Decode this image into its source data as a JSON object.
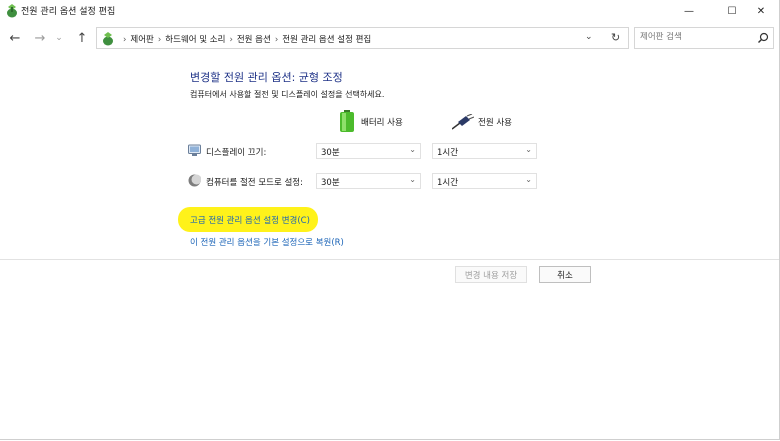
{
  "window": {
    "title": "전원 관리 옵션 설정 편집"
  },
  "titlebar": {
    "minimize": "—",
    "maximize": "☐",
    "close": "✕"
  },
  "nav": {
    "breadcrumbs": [
      "제어판",
      "하드웨어 및 소리",
      "전원 옵션",
      "전원 관리 옵션 설정 편집"
    ],
    "separator": "›",
    "search_placeholder": "제어판 검색"
  },
  "main": {
    "heading": "변경할 전원 관리 옵션: 균형 조정",
    "description": "컴퓨터에서 사용할 절전 및 디스플레이 설정을 선택하세요.",
    "columns": {
      "battery": "배터리 사용",
      "plugged_in": "전원 사용"
    },
    "settings": [
      {
        "label": "디스플레이 끄기:",
        "icon": "display-icon",
        "battery": "30분",
        "plugged_in": "1시간"
      },
      {
        "label": "컴퓨터를 절전 모드로 설정:",
        "icon": "moon-sleep-icon",
        "battery": "30분",
        "plugged_in": "1시간"
      }
    ],
    "advanced_link": "고급 전원 관리 옵션 설정 변경(C)",
    "restore_link": "이 전원 관리 옵션을 기본 설정으로 복원(R)",
    "highlight_color": "#fff21a"
  },
  "footer": {
    "save_label": "변경 내용 저장",
    "cancel_label": "취소"
  },
  "colors": {
    "heading": "#1e3287",
    "link": "#1b64b7"
  }
}
